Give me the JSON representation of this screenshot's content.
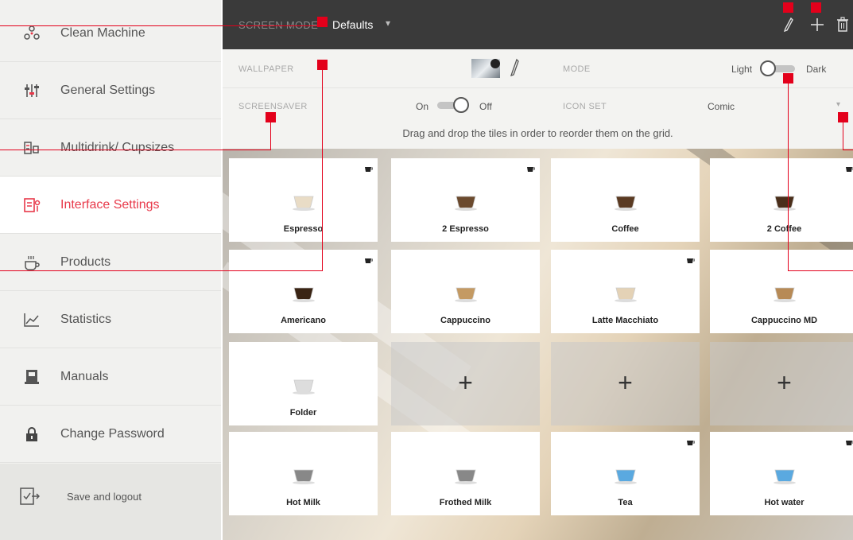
{
  "sidebar": {
    "items": [
      {
        "label": "Clean Machine",
        "icon": "clean-machine-icon"
      },
      {
        "label": "General Settings",
        "icon": "sliders-icon"
      },
      {
        "label": "Multidrink/ Cupsizes",
        "icon": "multidrink-icon"
      },
      {
        "label": "Interface Settings",
        "icon": "interface-settings-icon"
      },
      {
        "label": "Products",
        "icon": "products-icon"
      },
      {
        "label": "Statistics",
        "icon": "statistics-icon"
      },
      {
        "label": "Manuals",
        "icon": "manuals-icon"
      },
      {
        "label": "Change Password",
        "icon": "lock-icon"
      }
    ],
    "active_index": 3,
    "footer": {
      "label": "Save and logout",
      "icon": "logout-icon"
    }
  },
  "topbar": {
    "screen_mode_label": "SCREEN MODE",
    "screen_mode_value": "Defaults",
    "caret": "▾",
    "actions": [
      "edit-icon",
      "plus-icon",
      "trash-icon"
    ]
  },
  "settings": {
    "wallpaper_label": "WALLPAPER",
    "mode_label": "MODE",
    "mode_light": "Light",
    "mode_dark": "Dark",
    "screensaver_label": "SCREENSAVER",
    "screensaver_on": "On",
    "screensaver_off": "Off",
    "icon_set_label": "ICON SET",
    "icon_set_value": "Comic",
    "icon_set_caret": "▾"
  },
  "hint": "Drag and drop the tiles in order to reorder them on the grid.",
  "tiles": [
    {
      "label": "Espresso",
      "corner": true,
      "empty": false
    },
    {
      "label": "2 Espresso",
      "corner": true,
      "empty": false
    },
    {
      "label": "Coffee",
      "corner": false,
      "empty": false
    },
    {
      "label": "2 Coffee",
      "corner": true,
      "empty": false
    },
    {
      "label": "Americano",
      "corner": true,
      "empty": false
    },
    {
      "label": "Cappuccino",
      "corner": false,
      "empty": false
    },
    {
      "label": "Latte Macchiato",
      "corner": true,
      "empty": false
    },
    {
      "label": "Cappuccino MD",
      "corner": false,
      "empty": false
    },
    {
      "label": "Folder",
      "corner": false,
      "empty": false
    },
    {
      "label": "+",
      "corner": false,
      "empty": true
    },
    {
      "label": "+",
      "corner": false,
      "empty": true
    },
    {
      "label": "+",
      "corner": false,
      "empty": true
    },
    {
      "label": "Hot Milk",
      "corner": false,
      "empty": false
    },
    {
      "label": "Frothed Milk",
      "corner": false,
      "empty": false
    },
    {
      "label": "Tea",
      "corner": true,
      "empty": false
    },
    {
      "label": "Hot water",
      "corner": true,
      "empty": false
    }
  ],
  "colors": {
    "accent": "#e8394a",
    "callout": "#e3001b",
    "topbar": "#3a3a3a"
  }
}
